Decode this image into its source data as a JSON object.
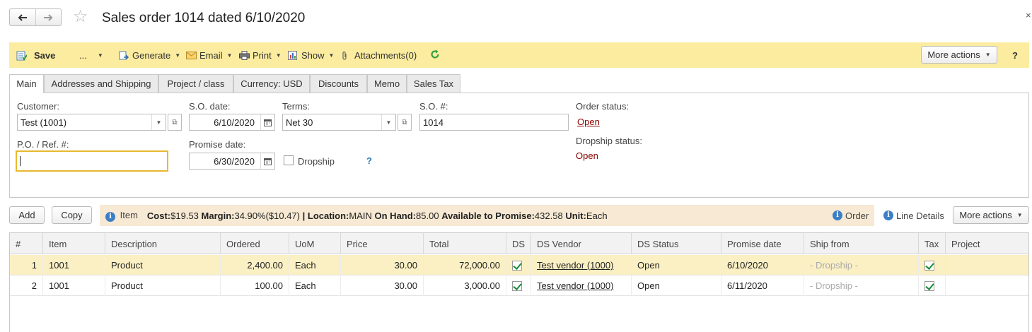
{
  "window": {
    "title": "Sales order 1014 dated 6/10/2020"
  },
  "toolbar": {
    "save": "Save",
    "more_dots": "...",
    "generate": "Generate",
    "email": "Email",
    "print": "Print",
    "show": "Show",
    "attachments": "Attachments(0)",
    "more_actions": "More actions",
    "help": "?"
  },
  "tabs": [
    "Main",
    "Addresses and Shipping",
    "Project / class",
    "Currency: USD",
    "Discounts",
    "Memo",
    "Sales Tax"
  ],
  "form": {
    "customer_label": "Customer:",
    "customer_value": "Test (1001)",
    "so_date_label": "S.O. date:",
    "so_date_value": "6/10/2020",
    "terms_label": "Terms:",
    "terms_value": "Net 30",
    "so_num_label": "S.O. #:",
    "so_num_value": "1014",
    "order_status_label": "Order status:",
    "order_status_value": "Open",
    "po_label": "P.O. / Ref. #:",
    "po_value": "",
    "promise_label": "Promise date:",
    "promise_value": "6/30/2020",
    "dropship_label": "Dropship",
    "dropship_help": "?",
    "dropship_status_label": "Dropship status:",
    "dropship_status_value": "Open"
  },
  "listbar": {
    "add": "Add",
    "copy": "Copy",
    "item_label": "Item",
    "info": {
      "cost_k": "Cost:",
      "cost_v": "$19.53",
      "margin_k": "Margin:",
      "margin_v": "34.90%($10.47)",
      "sep": "|",
      "location_k": "Location:",
      "location_v": "MAIN",
      "onhand_k": "On Hand:",
      "onhand_v": "85.00",
      "atp_k": "Available to Promise:",
      "atp_v": "432.58",
      "unit_k": "Unit:",
      "unit_v": "Each"
    },
    "order": "Order",
    "line_details": "Line Details",
    "more_actions": "More actions"
  },
  "table": {
    "columns": [
      "#",
      "Item",
      "Description",
      "Ordered",
      "UoM",
      "Price",
      "Total",
      "DS",
      "DS Vendor",
      "DS Status",
      "Promise date",
      "Ship from",
      "Tax",
      "Project"
    ],
    "rows": [
      {
        "n": "1",
        "item": "1001",
        "desc": "Product",
        "ordered": "2,400.00",
        "uom": "Each",
        "price": "30.00",
        "total": "72,000.00",
        "vendor": "Test vendor (1000)",
        "status": "Open",
        "promise": "6/10/2020",
        "ship": "- Dropship -"
      },
      {
        "n": "2",
        "item": "1001",
        "desc": "Product",
        "ordered": "100.00",
        "uom": "Each",
        "price": "30.00",
        "total": "3,000.00",
        "vendor": "Test vendor (1000)",
        "status": "Open",
        "promise": "6/11/2020",
        "ship": "- Dropship -"
      }
    ]
  },
  "colors": {
    "toolbar_bg": "#fbec9f",
    "selected_row": "#fbf0c4",
    "info_bar": "#f7e9d3",
    "status_red": "#8b0000",
    "focus_border": "#e8b830"
  }
}
